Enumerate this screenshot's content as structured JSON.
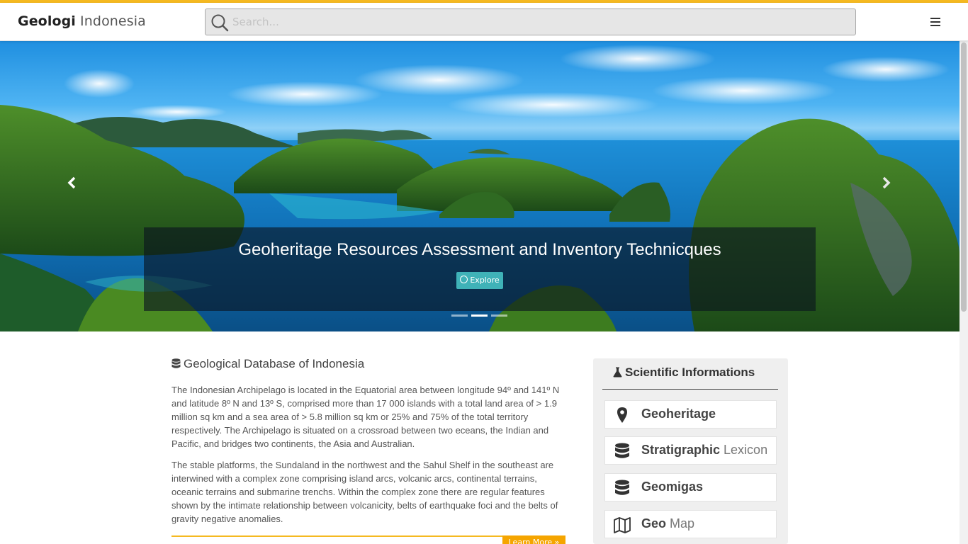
{
  "brand": {
    "bold": "Geologi",
    "light": " Indonesia"
  },
  "search": {
    "placeholder": "Search..."
  },
  "hero": {
    "caption": "Geoheritage Resources Assessment and Inventory Technicques",
    "button": "Explore",
    "slides": 3,
    "active_slide": 2
  },
  "database": {
    "title": "Geological Database of Indonesia",
    "paragraphs": [
      "The Indonesian Archipelago is located in the Equatorial area between longitude 94º and 141º N and latitude 8º N and 13º S, comprised more than 17 000 islands with a total land area of > 1.9 million sq km and a sea area of > 5.8 million sq km or 25% and 75% of the total territory respectively. The Archipelago is situated on a crossroad between two eceans, the Indian and Pacific, and bridges two continents, the Asia and Australian.",
      "The stable platforms, the Sundaland in the northwest and the Sahul Shelf in the southeast are interwined with a complex zone comprising island arcs, volcanic arcs, continental terrains, oceanic terrains and submarine trenchs. Within the complex zone there are regular features shown by the intimate relationship between volcanicity, belts of earthquake foci and the belts of gravity negative anomalies."
    ],
    "learn_more": "Learn More"
  },
  "sidebar": {
    "title": "Scientific Informations",
    "items": [
      {
        "bold": "Geoheritage",
        "light": "",
        "icon": "map-marker-icon"
      },
      {
        "bold": "Stratigraphic",
        "light": " Lexicon",
        "icon": "database-icon"
      },
      {
        "bold": "Geomigas",
        "light": "",
        "icon": "database-icon"
      },
      {
        "bold": "Geo",
        "light": " Map",
        "icon": "map-icon"
      }
    ]
  },
  "colors": {
    "accent": "#f5b921",
    "explore": "#3fb2b8",
    "learn_more": "#f5a500"
  }
}
